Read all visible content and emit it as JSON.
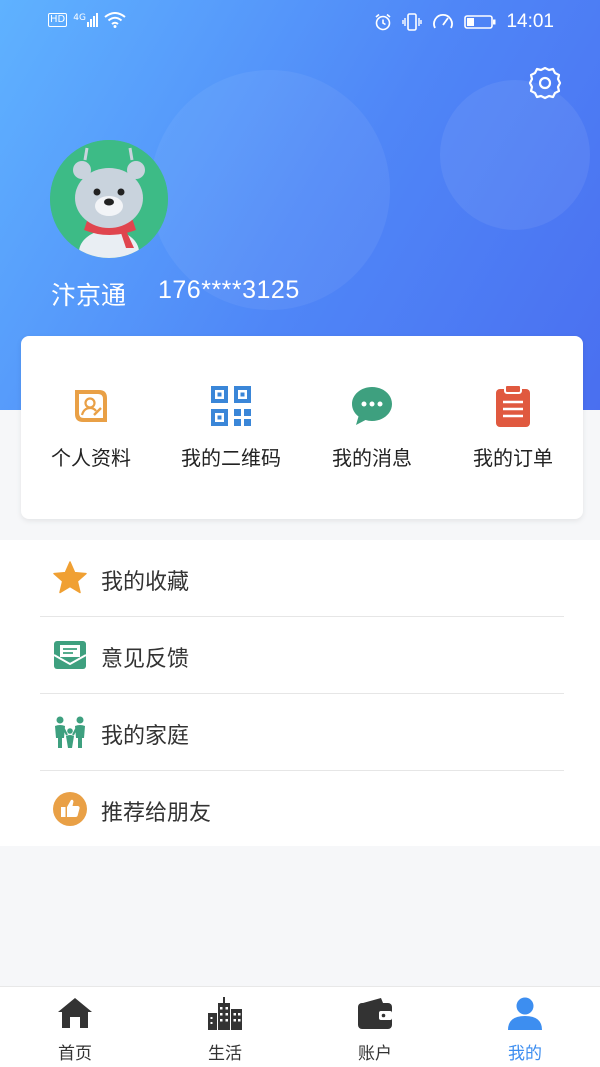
{
  "status_bar": {
    "network": "HD",
    "signal_type": "4G",
    "time": "14:01",
    "icons": [
      "alarm-icon",
      "vibrate-icon",
      "speed-icon",
      "battery-icon"
    ]
  },
  "header": {
    "settings_icon": "gear-icon",
    "username": "汴京通",
    "phone": "176****3125"
  },
  "quick_actions": [
    {
      "label": "个人资料",
      "icon": "profile-card-icon",
      "color": "#e9a046"
    },
    {
      "label": "我的二维码",
      "icon": "qr-code-icon",
      "color": "#3a86d8"
    },
    {
      "label": "我的消息",
      "icon": "message-bubble-icon",
      "color": "#3ea07f"
    },
    {
      "label": "我的订单",
      "icon": "clipboard-icon",
      "color": "#e0593f"
    }
  ],
  "menu": [
    {
      "label": "我的收藏",
      "icon": "star-icon",
      "color": "#f0a033"
    },
    {
      "label": "意见反馈",
      "icon": "feedback-mail-icon",
      "color": "#3ea07f"
    },
    {
      "label": "我的家庭",
      "icon": "family-icon",
      "color": "#3ea07f"
    },
    {
      "label": "推荐给朋友",
      "icon": "thumbs-up-icon",
      "color": "#e9a046"
    }
  ],
  "tabbar": [
    {
      "label": "首页",
      "icon": "home-icon"
    },
    {
      "label": "生活",
      "icon": "city-icon"
    },
    {
      "label": "账户",
      "icon": "wallet-icon"
    },
    {
      "label": "我的",
      "icon": "person-icon",
      "active": true
    }
  ],
  "colors": {
    "accent": "#3d8ef0",
    "header_gradient_start": "#5fb2ff",
    "header_gradient_end": "#4a6ff0"
  }
}
